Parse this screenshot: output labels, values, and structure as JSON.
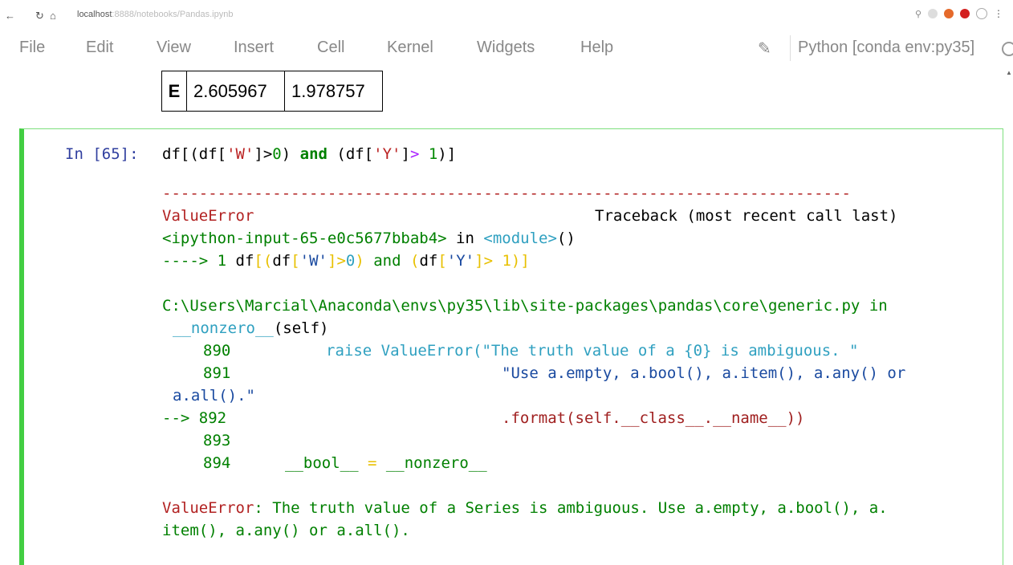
{
  "browser": {
    "url_host": "localhost",
    "url_rest": ":8888/notebooks/Pandas.ipynb"
  },
  "menu": {
    "items": [
      "File",
      "Edit",
      "View",
      "Insert",
      "Cell",
      "Kernel",
      "Widgets",
      "Help"
    ],
    "kernel": "Python [conda env:py35]"
  },
  "table": {
    "row_label": "E",
    "values": [
      "2.605967",
      "1.978757"
    ]
  },
  "cell": {
    "prompt": "In [65]:",
    "code": {
      "p1": "df[(df[",
      "s1": "'W'",
      "p2": "]>",
      "n1": "0",
      "p3": ") ",
      "kw": "and",
      "p4": " (df[",
      "s2": "'Y'",
      "p5": "]",
      "op": ">",
      "n2": " 1",
      "p6": ")]"
    }
  },
  "traceback": {
    "dashes": "---------------------------------------------------------------------------",
    "error_name": "ValueError",
    "header_right": "Traceback (most recent call last)",
    "input_ref": "<ipython-input-65-e0c5677bbab4>",
    "in_word": " in ",
    "module": "<module>",
    "module_parens": "()",
    "arrow1": "----> 1 ",
    "l1a": "df",
    "l1b": "[",
    "l1c": "(",
    "l1d": "df",
    "l1e": "[",
    "l1f": "'W'",
    "l1g": "]",
    "l1h": ">",
    "l1i": "0",
    "l1j": ")",
    "l1k": " and ",
    "l1l": "(",
    "l1m": "df",
    "l1n": "[",
    "l1o": "'Y'",
    "l1p": "]",
    "l1q": "> 1",
    "l1r": ")",
    "l1s": "]",
    "path": "C:\\Users\\Marcial\\Anaconda\\envs\\py35\\lib\\site-packages\\pandas\\core\\generic.py",
    "path_in": " in",
    "func": "__nonzero__",
    "func_args": "(self)",
    "ln890": "890",
    "code890a": "raise ValueError(",
    "code890b": "\"The truth value of a {0} is ambiguous. \"",
    "ln891": "891",
    "code891": "\"Use a.empty, a.bool(), a.item(), a.any() or",
    "code891b": "a.all().\"",
    "arrow892": "--> 892",
    "code892": ".format(self.__class__.__name__))",
    "ln893": "893",
    "ln894": "894",
    "code894a": "__bool__",
    "code894b": " = ",
    "code894c": "__nonzero__",
    "final_name": "ValueError",
    "final_msg1": ": The truth value of a Series is ambiguous. Use a.empty, a.bool(), a.",
    "final_msg2": "item(), a.any() or a.all()."
  }
}
